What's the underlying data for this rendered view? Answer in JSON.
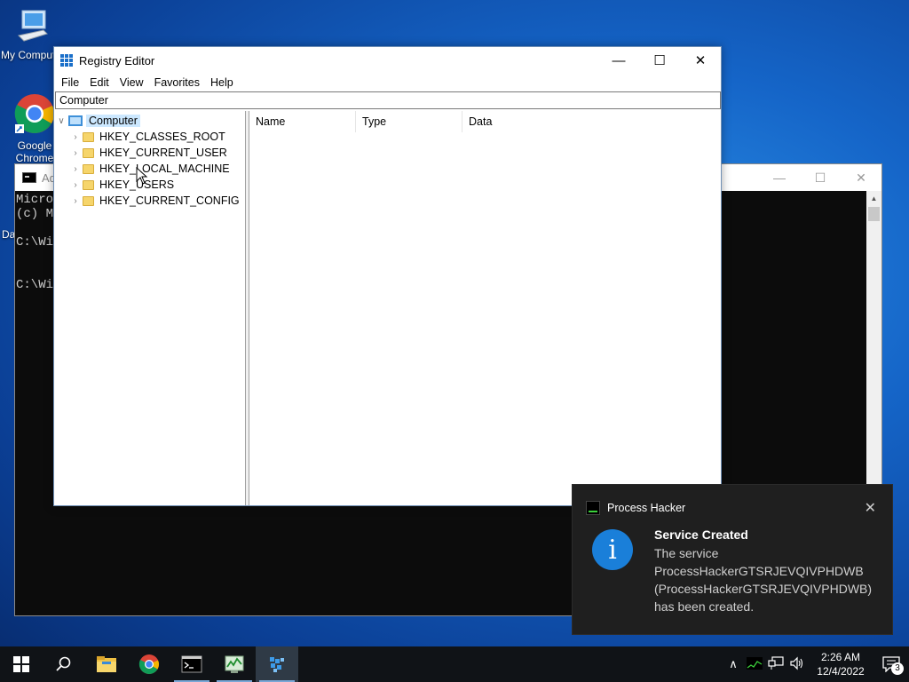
{
  "desktop": {
    "icons": [
      {
        "label": "My Computer",
        "icon": "computer-icon"
      },
      {
        "label": "Google Chrome",
        "icon": "chrome-icon"
      }
    ],
    "partial_label": "Da"
  },
  "console": {
    "title": "Ad",
    "lines": [
      "Micro",
      "(c) Mi",
      "",
      "C:\\Wi",
      "",
      "",
      "C:\\Wi"
    ]
  },
  "regedit": {
    "title": "Registry Editor",
    "menu": [
      "File",
      "Edit",
      "View",
      "Favorites",
      "Help"
    ],
    "address": "Computer",
    "tree_root": "Computer",
    "tree_items": [
      "HKEY_CLASSES_ROOT",
      "HKEY_CURRENT_USER",
      "HKEY_LOCAL_MACHINE",
      "HKEY_USERS",
      "HKEY_CURRENT_CONFIG"
    ],
    "columns": [
      "Name",
      "Type",
      "Data"
    ]
  },
  "toast": {
    "app": "Process Hacker",
    "title": "Service Created",
    "lines": [
      "The service",
      "ProcessHackerGTSRJEVQIVPHDWB",
      "(ProcessHackerGTSRJEVQIVPHDWB)",
      "has been created."
    ]
  },
  "taskbar": {
    "apps": [
      "start-icon",
      "search-icon",
      "file-explorer-icon",
      "chrome-icon",
      "cmd-icon",
      "task-manager-icon",
      "regedit-icon"
    ],
    "clock_time": "2:26 AM",
    "clock_date": "12/4/2022",
    "notification_count": "3"
  },
  "colors": {
    "accent": "#1a7fd9",
    "taskbar": "#101317",
    "toast_bg": "#1f1f1f"
  }
}
